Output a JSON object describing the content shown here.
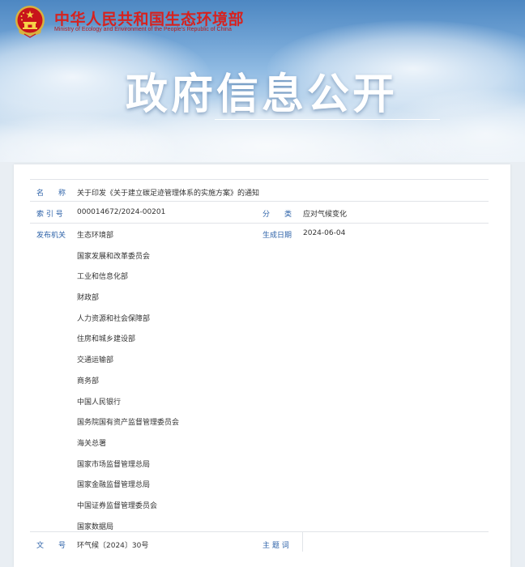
{
  "site": {
    "name_cn": "中华人民共和国生态环境部",
    "name_en": "Ministry of Ecology and Environment of the People's Republic of China",
    "banner_title": "政府信息公开"
  },
  "document": {
    "name_label": "名　　称",
    "name_value": "关于印发《关于建立碳足迹管理体系的实施方案》的通知",
    "index_label": "索 引 号",
    "index_value": "000014672/2024-00201",
    "category_label": "分　　类",
    "category_value": "应对气候变化",
    "issuer_label": "发布机关",
    "issuers": [
      "生态环境部",
      "国家发展和改革委员会",
      "工业和信息化部",
      "财政部",
      "人力资源和社会保障部",
      "住房和城乡建设部",
      "交通运输部",
      "商务部",
      "中国人民银行",
      "国务院国有资产监督管理委员会",
      "海关总署",
      "国家市场监督管理总局",
      "国家金融监督管理总局",
      "中国证券监督管理委员会",
      "国家数据局"
    ],
    "date_label": "生成日期",
    "date_value": "2024-06-04",
    "docno_label": "文　　号",
    "docno_value": "环气候〔2024〕30号",
    "keywords_label": "主 题 词",
    "keywords_value": ""
  },
  "colors": {
    "ministry_red": "#d6221f",
    "label_blue": "#2d62a8",
    "value_text": "#333333"
  }
}
